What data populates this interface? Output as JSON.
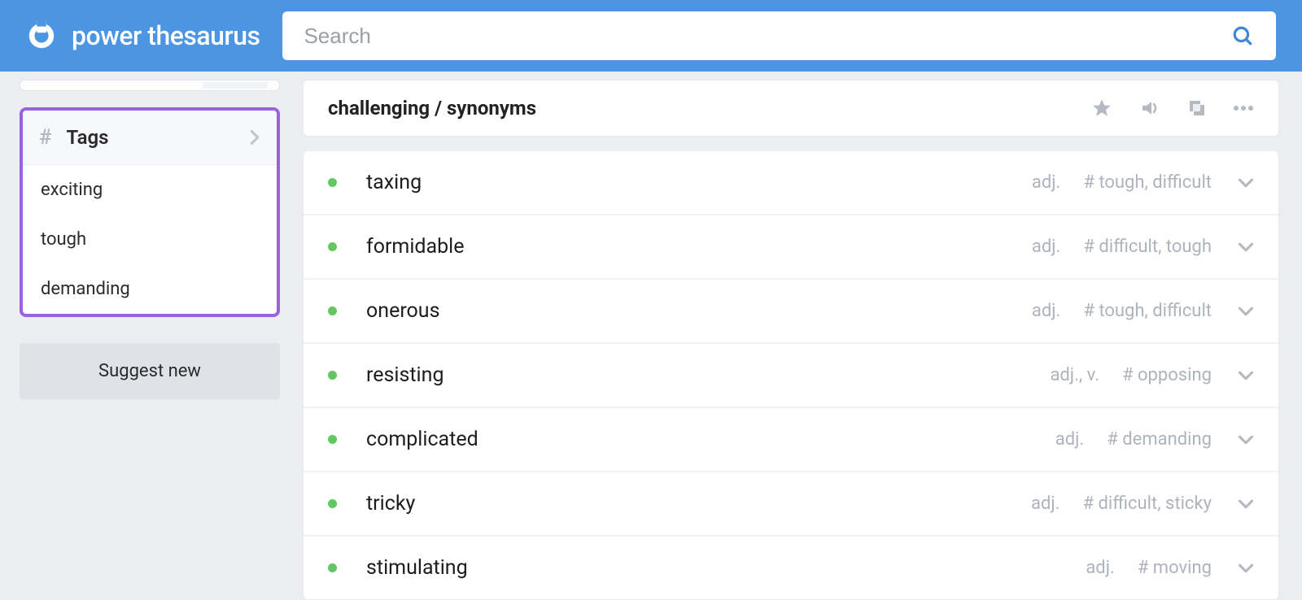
{
  "header": {
    "brand": "power thesaurus",
    "search_placeholder": "Search"
  },
  "sidebar": {
    "tags_header": "Tags",
    "tags": [
      "exciting",
      "tough",
      "demanding"
    ],
    "suggest_label": "Suggest new"
  },
  "page": {
    "title": "challenging / synonyms"
  },
  "results": [
    {
      "word": "taxing",
      "pos": "adj.",
      "tags": "# tough, difficult"
    },
    {
      "word": "formidable",
      "pos": "adj.",
      "tags": "# difficult, tough"
    },
    {
      "word": "onerous",
      "pos": "adj.",
      "tags": "# tough, difficult"
    },
    {
      "word": "resisting",
      "pos": "adj., v.",
      "tags": "# opposing"
    },
    {
      "word": "complicated",
      "pos": "adj.",
      "tags": "# demanding"
    },
    {
      "word": "tricky",
      "pos": "adj.",
      "tags": "# difficult, sticky"
    },
    {
      "word": "stimulating",
      "pos": "adj.",
      "tags": "# moving"
    }
  ]
}
